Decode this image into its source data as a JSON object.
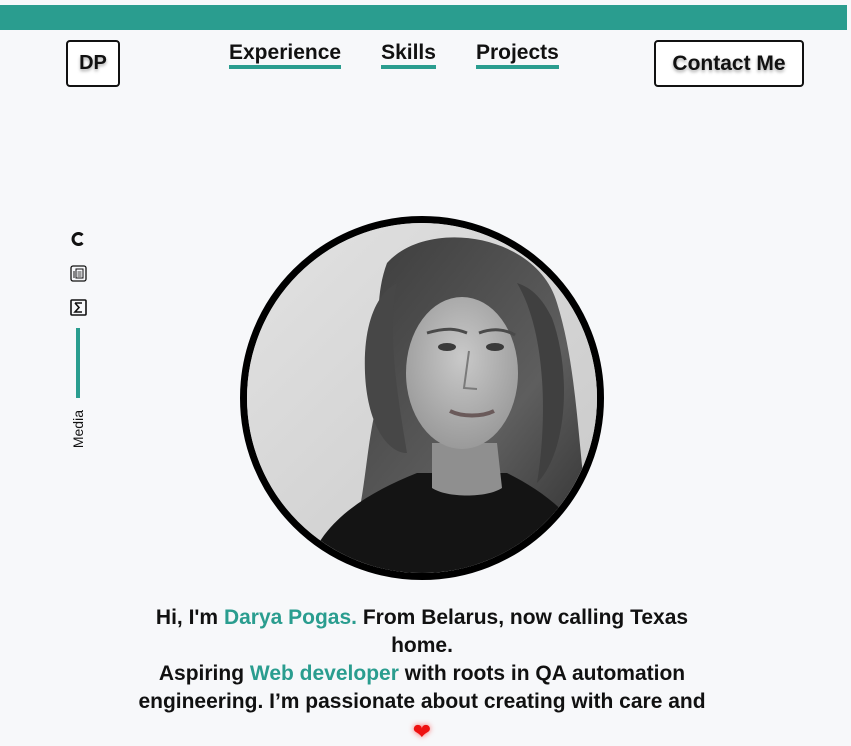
{
  "header": {
    "logo": "DP",
    "nav": [
      "Experience",
      "Skills",
      "Projects"
    ],
    "contact_label": "Contact Me"
  },
  "media": {
    "label": "Media",
    "icons": [
      "codepen-icon",
      "document-icon",
      "sigma-icon"
    ]
  },
  "intro": {
    "greeting": "Hi, I'm",
    "name": "Darya Pogas.",
    "line1_rest": "From Belarus, now calling Texas home.",
    "aspiring": "Aspiring",
    "role": "Web developer",
    "line2_rest": "with roots in QA automation engineering. I’m passionate about creating with care and"
  },
  "colors": {
    "accent": "#2a9d8f",
    "background": "#f7f8fa",
    "heart": "#ee1111"
  }
}
